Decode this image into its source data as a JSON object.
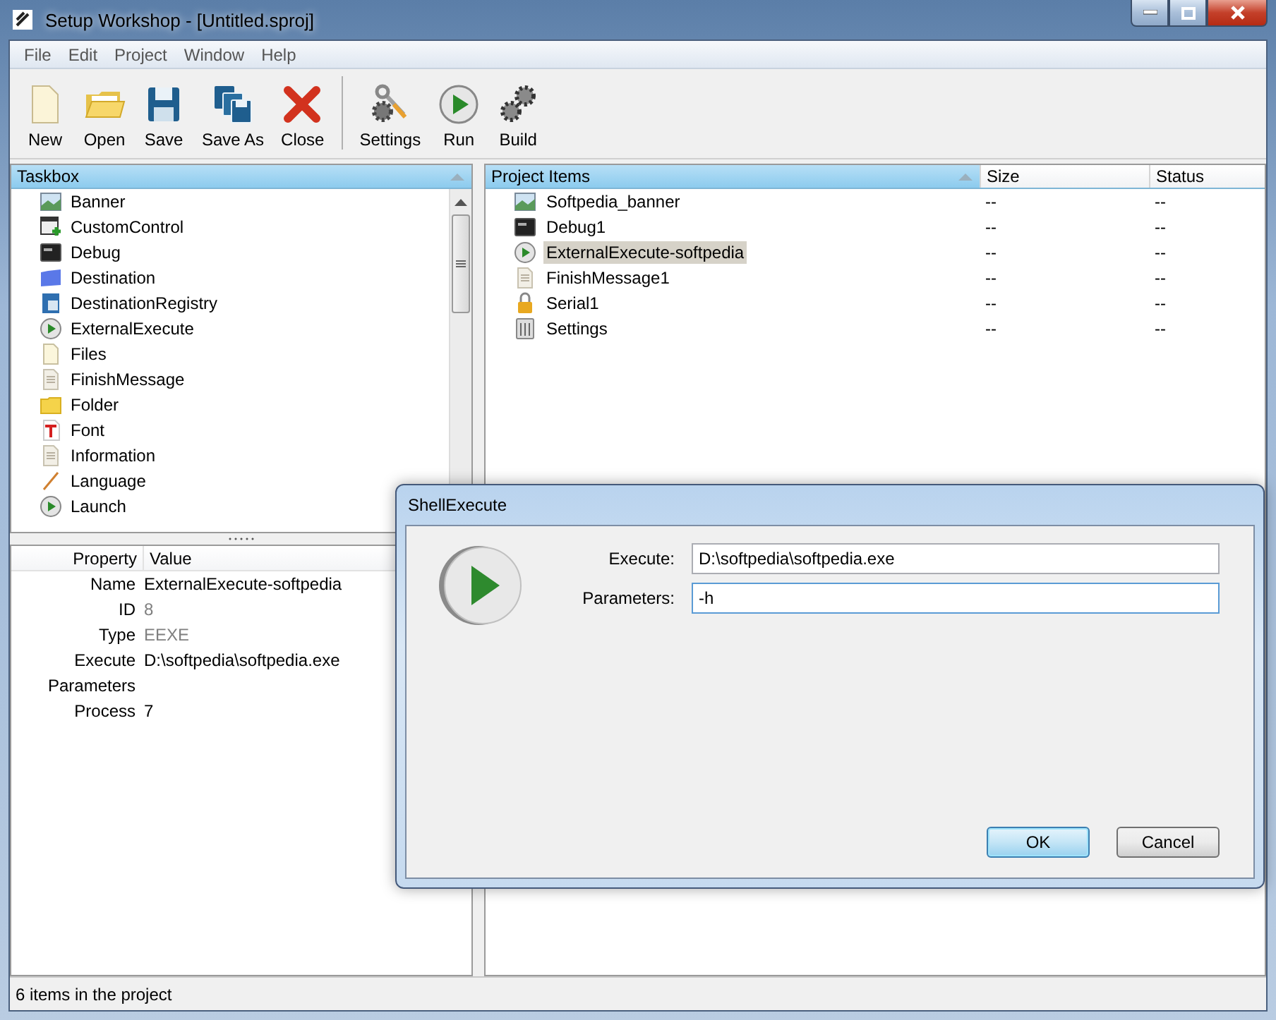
{
  "window": {
    "title": "Setup Workshop - [Untitled.sproj]"
  },
  "menu": [
    "File",
    "Edit",
    "Project",
    "Window",
    "Help"
  ],
  "toolbar": [
    {
      "label": "New",
      "kind": "new"
    },
    {
      "label": "Open",
      "kind": "open"
    },
    {
      "label": "Save",
      "kind": "save"
    },
    {
      "label": "Save As",
      "kind": "saveas"
    },
    {
      "label": "Close",
      "kind": "close"
    },
    {
      "label": "Settings",
      "kind": "settings",
      "group_start": true
    },
    {
      "label": "Run",
      "kind": "run"
    },
    {
      "label": "Build",
      "kind": "build"
    }
  ],
  "taskbox": {
    "header": "Taskbox",
    "items": [
      {
        "label": "Banner",
        "kind": "banner"
      },
      {
        "label": "CustomControl",
        "kind": "control"
      },
      {
        "label": "Debug",
        "kind": "console"
      },
      {
        "label": "Destination",
        "kind": "bluefolder"
      },
      {
        "label": "DestinationRegistry",
        "kind": "registry"
      },
      {
        "label": "ExternalExecute",
        "kind": "play"
      },
      {
        "label": "Files",
        "kind": "page"
      },
      {
        "label": "FinishMessage",
        "kind": "note"
      },
      {
        "label": "Folder",
        "kind": "folder"
      },
      {
        "label": "Font",
        "kind": "font"
      },
      {
        "label": "Information",
        "kind": "note"
      },
      {
        "label": "Language",
        "kind": "pen"
      },
      {
        "label": "Launch",
        "kind": "play"
      }
    ]
  },
  "properties": {
    "columns": [
      "Property",
      "Value"
    ],
    "rows": [
      {
        "property": "Name",
        "value": "ExternalExecute-softpedia",
        "readonly": false
      },
      {
        "property": "ID",
        "value": "8",
        "readonly": true
      },
      {
        "property": "Type",
        "value": "EEXE",
        "readonly": true
      },
      {
        "property": "Execute",
        "value": "D:\\softpedia\\softpedia.exe",
        "readonly": false
      },
      {
        "property": "Parameters"
      },
      {
        "property": "Process",
        "value": "7",
        "readonly": false
      }
    ]
  },
  "project": {
    "columns": [
      "Project Items",
      "Size",
      "Status"
    ],
    "rows": [
      {
        "name": "Softpedia_banner",
        "kind": "banner",
        "size": "--",
        "status": "--",
        "selected": false
      },
      {
        "name": "Debug1",
        "kind": "console",
        "size": "--",
        "status": "--",
        "selected": false
      },
      {
        "name": "ExternalExecute-softpedia",
        "kind": "play",
        "size": "--",
        "status": "--",
        "selected": true
      },
      {
        "name": "FinishMessage1",
        "kind": "note",
        "size": "--",
        "status": "--",
        "selected": false
      },
      {
        "name": "Serial1",
        "kind": "lock",
        "size": "--",
        "status": "--",
        "selected": false
      },
      {
        "name": "Settings",
        "kind": "sliders",
        "size": "--",
        "status": "--",
        "selected": false
      }
    ]
  },
  "dialog": {
    "title": "ShellExecute",
    "fields": [
      {
        "label": "Execute:",
        "value": "D:\\softpedia\\softpedia.exe",
        "focused": false
      },
      {
        "label": "Parameters:",
        "value": "-h",
        "focused": true
      }
    ],
    "buttons": [
      {
        "label": "OK",
        "default": true
      },
      {
        "label": "Cancel",
        "default": false
      }
    ]
  },
  "status_bar": "6 items in the project"
}
